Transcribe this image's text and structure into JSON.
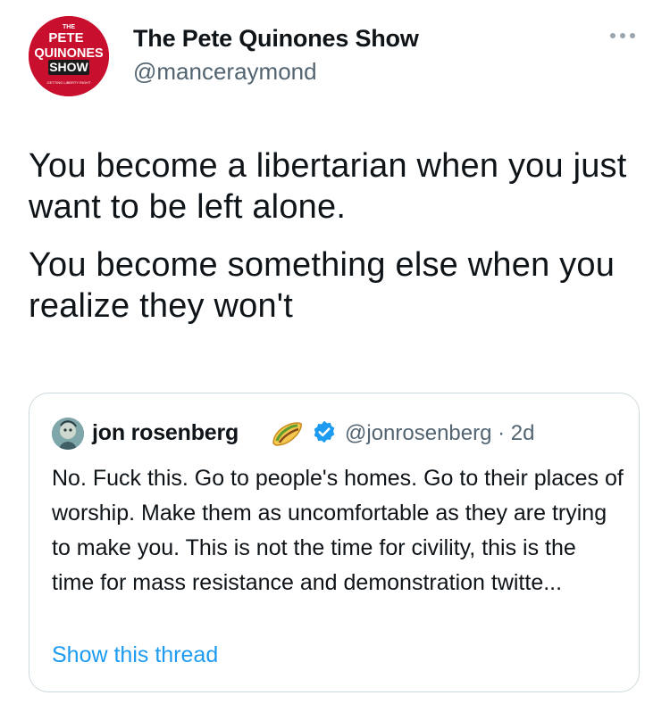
{
  "author": {
    "display_name": "The Pete Quinones Show",
    "handle": "@manceraymond",
    "avatar_logo": {
      "line1": "THE",
      "line2": "PETE",
      "line3": "QUINONES",
      "line4": "SHOW",
      "tagline": "GETTING LIBERTY RIGHT",
      "bg_color": "#c8102e"
    }
  },
  "more_icon": "more-horizontal-icon",
  "tweet": {
    "paragraphs": [
      "You become a libertarian when you just want to be left alone.",
      "You become something else when you realize they won't"
    ]
  },
  "quoted_tweet": {
    "display_name": "jon rosenberg",
    "name_emoji": "taco-icon",
    "verified_icon": "verified-badge-icon",
    "handle_time": "@jonrosenberg · 2d",
    "text": "No. Fuck this. Go to people's homes. Go to their places of worship. Make them as uncomfortable as they are trying to make you. This is not the time for civility, this is the time for mass resistance and demonstration twitte...",
    "show_thread": "Show this thread"
  },
  "colors": {
    "text_primary": "#0f1419",
    "text_secondary": "#536471",
    "link": "#1d9bf0",
    "border": "#cfd9de",
    "verified": "#1d9bf0"
  }
}
